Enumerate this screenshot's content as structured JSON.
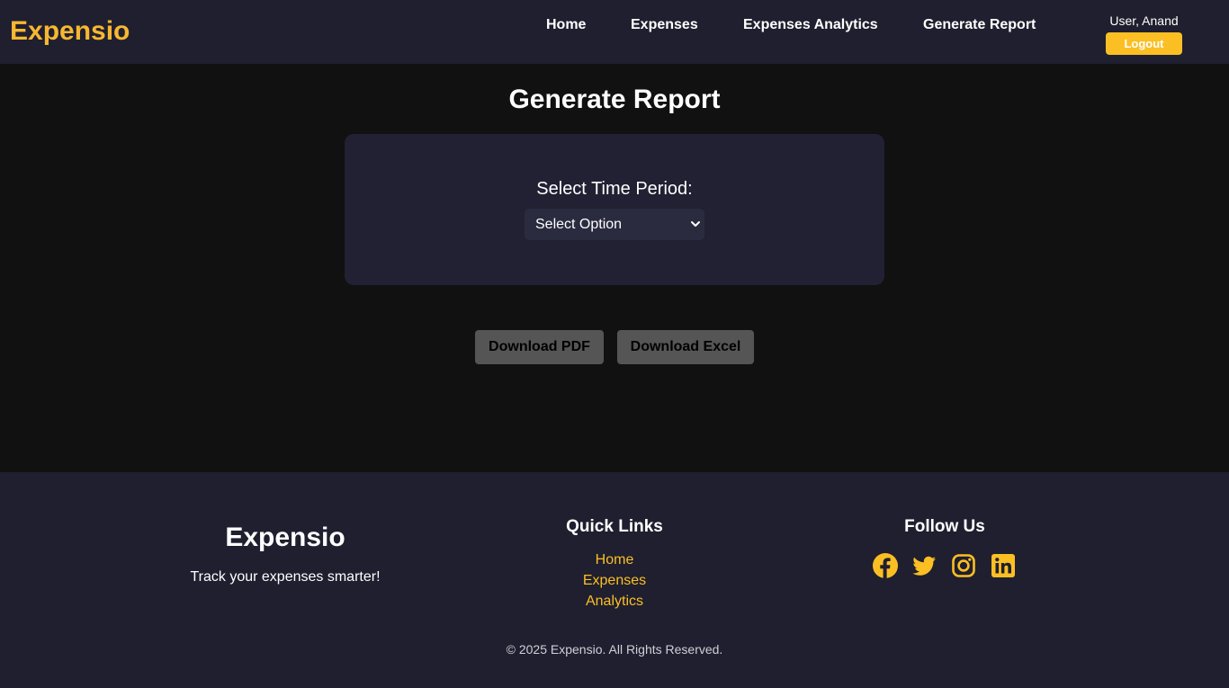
{
  "navbar": {
    "brand": "Expensio",
    "links": [
      "Home",
      "Expenses",
      "Expenses Analytics",
      "Generate Report"
    ],
    "user_label": "User, Anand",
    "logout_label": "Logout"
  },
  "main": {
    "title": "Generate Report",
    "period_label": "Select Time Period:",
    "period_select_value": "Select Option",
    "download_pdf_label": "Download PDF",
    "download_excel_label": "Download Excel"
  },
  "footer": {
    "brand": "Expensio",
    "tagline": "Track your expenses smarter!",
    "quick_links_heading": "Quick Links",
    "quick_links": [
      "Home",
      "Expenses",
      "Analytics"
    ],
    "follow_heading": "Follow Us",
    "social_icons": [
      "facebook-icon",
      "twitter-icon",
      "instagram-icon",
      "linkedin-icon"
    ],
    "copyright": "© 2025 Expensio. All Rights Reserved."
  },
  "colors": {
    "accent": "#fbbf24",
    "nav_bg": "#1f1f2f",
    "page_bg": "#111111",
    "card_bg": "#212133",
    "button_bg": "#555555"
  }
}
